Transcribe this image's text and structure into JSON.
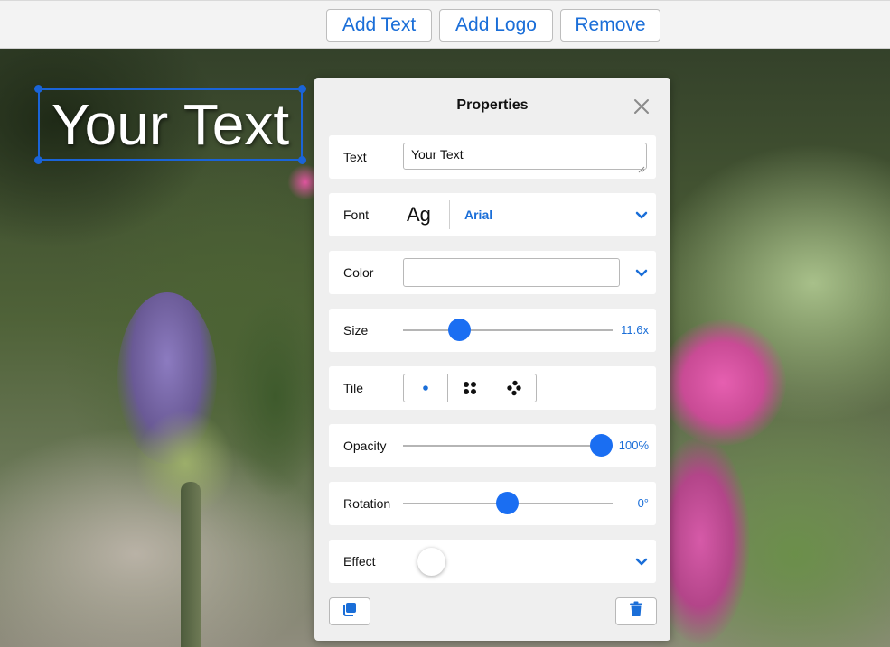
{
  "toolbar": {
    "add_text_label": "Add Text",
    "add_logo_label": "Add Logo",
    "remove_label": "Remove"
  },
  "canvas": {
    "overlay_text": "Your Text"
  },
  "panel": {
    "title": "Properties",
    "text_row": {
      "label": "Text",
      "value": "Your Text"
    },
    "font_row": {
      "label": "Font",
      "preview": "Ag",
      "selected": "Arial"
    },
    "color_row": {
      "label": "Color",
      "value": "#ffffff"
    },
    "size_row": {
      "label": "Size",
      "value_text": "11.6x",
      "fraction": 0.27
    },
    "tile_row": {
      "label": "Tile",
      "options": [
        "single",
        "grid",
        "scatter"
      ],
      "selected": "single"
    },
    "opacity_row": {
      "label": "Opacity",
      "value_text": "100%",
      "fraction": 1.0
    },
    "rotation_row": {
      "label": "Rotation",
      "value_text": "0°",
      "fraction": 0.5
    },
    "effect_row": {
      "label": "Effect",
      "enabled": false
    }
  },
  "colors": {
    "accent": "#1a6ed8",
    "slider_thumb": "#1a6ef2",
    "selection_border": "#1a64d8",
    "panel_bg": "#efefef"
  },
  "icons": {
    "close": "close-icon",
    "chevron": "chevron-down-icon",
    "duplicate": "duplicate-icon",
    "delete": "trash-icon"
  }
}
